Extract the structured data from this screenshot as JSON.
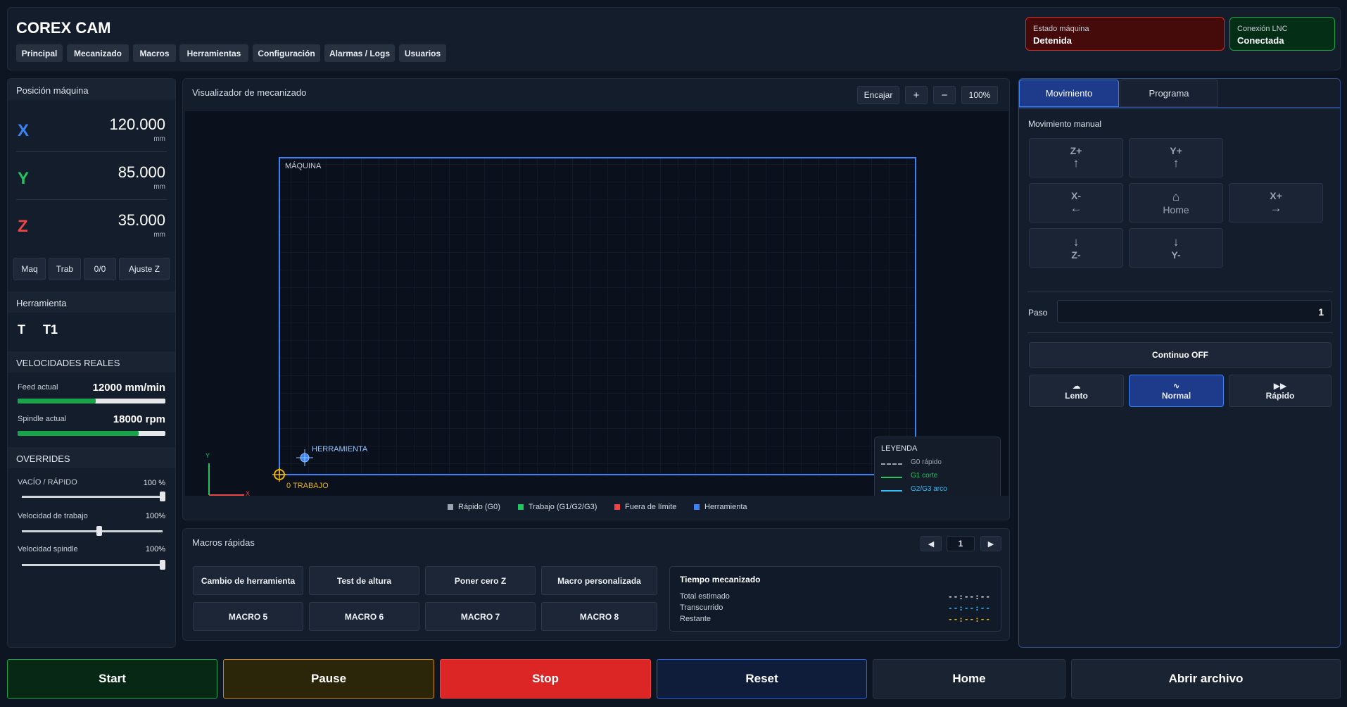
{
  "app": {
    "title": "COREX CAM"
  },
  "nav": {
    "tabs": [
      {
        "label": "Principal"
      },
      {
        "label": "Mecanizado"
      },
      {
        "label": "Macros"
      },
      {
        "label": "Herramientas"
      },
      {
        "label": "Configuración"
      },
      {
        "label": "Alarmas / Logs"
      },
      {
        "label": "Usuarios"
      }
    ]
  },
  "status": {
    "machine": {
      "label": "Estado máquina",
      "value": "Detenida",
      "color": "#dc2626"
    },
    "lnc": {
      "label": "Conexión LNC",
      "value": "Conectada",
      "color": "#16a34a"
    }
  },
  "position": {
    "title": "Posición máquina",
    "axes": [
      {
        "name": "X",
        "value": "120.000",
        "unit": "mm",
        "color": "#3b82f6"
      },
      {
        "name": "Y",
        "value": "85.000",
        "unit": "mm",
        "color": "#22c55e"
      },
      {
        "name": "Z",
        "value": "35.000",
        "unit": "mm",
        "color": "#ef4444"
      }
    ],
    "buttons": [
      "Maq",
      "Trab",
      "0/0",
      "Ajuste Z"
    ]
  },
  "tool": {
    "title": "Herramienta",
    "letter": "T",
    "value": "T1"
  },
  "speeds": {
    "title": "VELOCIDADES REALES",
    "feed": {
      "label": "Feed actual",
      "value": "12000 mm/min",
      "fill": 0.53
    },
    "spindle": {
      "label": "Spindle actual",
      "value": "18000 rpm",
      "fill": 0.82
    }
  },
  "overrides": {
    "title": "OVERRIDES",
    "items": [
      {
        "label": "VACÍO / RÁPIDO",
        "value": "100 %",
        "level": 1.0
      },
      {
        "label": "Velocidad de trabajo",
        "value": "100%",
        "level": 0.55
      },
      {
        "label": "Velocidad spindle",
        "value": "100%",
        "level": 1.0
      }
    ]
  },
  "viz": {
    "title": "Visualizador de mecanizado",
    "fit": "Encajar",
    "zoom_in": "+",
    "zoom_out": "−",
    "zoom": "100%",
    "machine_label": "MÁQUINA",
    "tool_label": "HERRAMIENTA",
    "work_zero_label": "0 TRABAJO",
    "axis_y": "Y",
    "axis_x": "X",
    "legend": {
      "title": "LEYENDA",
      "items": [
        {
          "label": "G0 rápido",
          "color": "#9ca3af"
        },
        {
          "label": "G1 corte",
          "color": "#22c55e"
        },
        {
          "label": "G2/G3 arco",
          "color": "#38bdf8"
        }
      ]
    },
    "footer": [
      {
        "label": "Rápido (G0)",
        "color": "#9ca3af"
      },
      {
        "label": "Trabajo (G1/G2/G3)",
        "color": "#22c55e"
      },
      {
        "label": "Fuera de límite",
        "color": "#ef4444"
      },
      {
        "label": "Herramienta",
        "color": "#3b82f6"
      }
    ]
  },
  "macros": {
    "title": "Macros rápidas",
    "page": "1",
    "prev": "◀",
    "next": "▶",
    "buttons": [
      "Cambio de herramienta",
      "Test de altura",
      "Poner cero Z",
      "Macro personalizada",
      "MACRO 5",
      "MACRO 6",
      "MACRO 7",
      "MACRO 8"
    ]
  },
  "time": {
    "title": "Tiempo mecanizado",
    "rows": [
      {
        "label": "Total estimado",
        "value": "--:--:--",
        "color": "#e5e7eb"
      },
      {
        "label": "Transcurrido",
        "value": "--:--:--",
        "color": "#38bdf8"
      },
      {
        "label": "Restante",
        "value": "--:--:--",
        "color": "#eab308"
      }
    ]
  },
  "right": {
    "tabs": [
      "Movimiento",
      "Programa"
    ],
    "manual_title": "Movimiento manual",
    "jog": {
      "zplus": {
        "label": "Z+",
        "arrow": "↑"
      },
      "yplus": {
        "label": "Y+",
        "arrow": "↑"
      },
      "xminus": {
        "label": "X-",
        "arrow": "←"
      },
      "home": {
        "label": "Home",
        "arrow": "⌂"
      },
      "xplus": {
        "label": "X+",
        "arrow": "→"
      },
      "zminus": {
        "label": "Z-",
        "arrow": "↓"
      },
      "yminus": {
        "label": "Y-",
        "arrow": "↓"
      }
    },
    "step_label": "Paso",
    "step_value": "1",
    "continuous": "Continuo OFF",
    "speeds": [
      {
        "label": "Lento",
        "icon": "☁"
      },
      {
        "label": "Normal",
        "icon": "∿"
      },
      {
        "label": "Rápido",
        "icon": "▶▶"
      }
    ]
  },
  "actions": {
    "start": "Start",
    "pause": "Pause",
    "stop": "Stop",
    "reset": "Reset",
    "home": "Home",
    "open": "Abrir archivo"
  }
}
